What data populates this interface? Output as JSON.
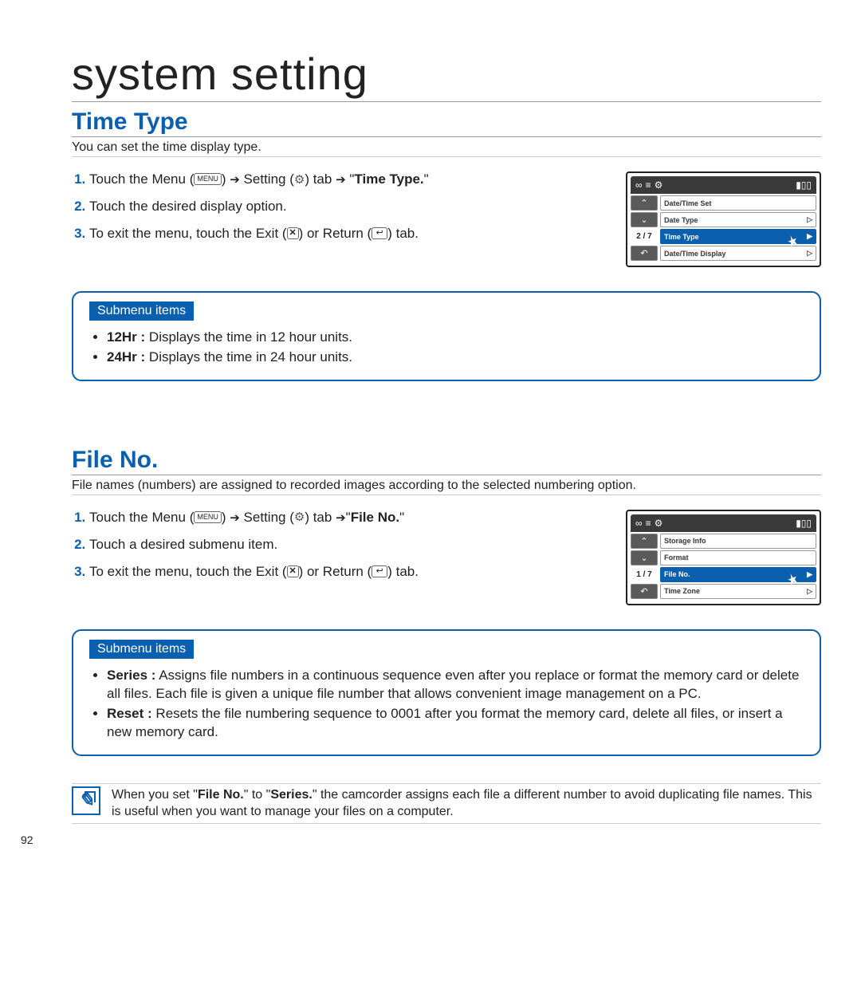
{
  "page": {
    "title": "system setting",
    "number": "92"
  },
  "sectionA": {
    "heading": "Time Type",
    "intro": "You can set the time display type.",
    "steps": {
      "s1a": "Touch the Menu (",
      "menu_label": "MENU",
      "s1b": ") ",
      "s1c": " Setting (",
      "s1d": ") tab ",
      "s1e": " \"",
      "s1f": "Time Type.",
      "s1g": "\"",
      "s2": "Touch the desired display option.",
      "s3a": "To exit the menu, touch the Exit (",
      "s3b": ") or Return (",
      "s3c": ") tab."
    },
    "submenu": {
      "title": "Submenu items",
      "item1_name": "12Hr :",
      "item1_desc": " Displays the time in 12 hour units.",
      "item2_name": "24Hr :",
      "item2_desc": " Displays the time in 24 hour units."
    },
    "shot": {
      "page": "2 / 7",
      "rows": [
        "Date/Time Set",
        "Date Type",
        "Time Type",
        "Date/Time Display"
      ]
    }
  },
  "sectionB": {
    "heading": "File No.",
    "intro": "File names (numbers) are assigned to recorded images according to the selected numbering option.",
    "steps": {
      "s1a": "Touch the Menu (",
      "menu_label": "MENU",
      "s1b": ") ",
      "s1c": " Setting (",
      "s1d": ") tab ",
      "s1e": "\"",
      "s1f": "File No.",
      "s1g": "\"",
      "s2": "Touch a desired submenu item.",
      "s3a": "To exit the menu, touch the Exit (",
      "s3b": ") or Return (",
      "s3c": ") tab."
    },
    "submenu": {
      "title": "Submenu items",
      "item1_name": "Series :",
      "item1_desc": " Assigns file numbers in a continuous sequence even after you replace or format the memory card or delete all files. Each file is given a unique file number that allows convenient image management on a PC.",
      "item2_name": "Reset :",
      "item2_desc": " Resets the file numbering sequence to 0001 after you format the memory card, delete all files, or insert a new memory card."
    },
    "shot": {
      "page": "1 / 7",
      "rows": [
        "Storage Info",
        "Format",
        "File No.",
        "Time Zone"
      ]
    }
  },
  "note": {
    "p1a": "When you set \"",
    "p1b": "File No.",
    "p1c": "\" to \"",
    "p1d": "Series.",
    "p1e": "\" the camcorder assigns each file a different number to avoid duplicating file names. This is useful when you want to manage your files on a computer."
  },
  "icons": {
    "x": "✕",
    "return": "↩",
    "arrow": "➔",
    "gear": "⚙",
    "up": "⌃",
    "down": "⌄",
    "back": "↶",
    "tri": "▷",
    "tri_fill": "▶",
    "cam": "∞",
    "list": "≡",
    "batt": "▮▯▯"
  }
}
